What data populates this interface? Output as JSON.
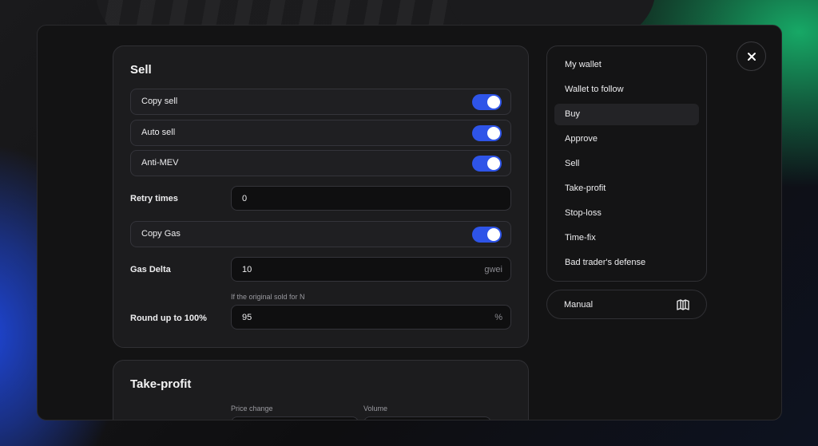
{
  "sell": {
    "title": "Sell",
    "toggles": [
      {
        "label": "Copy sell",
        "on": true
      },
      {
        "label": "Auto sell",
        "on": true
      },
      {
        "label": "Anti-MEV",
        "on": true
      }
    ],
    "retry": {
      "label": "Retry times",
      "value": "0"
    },
    "copy_gas": {
      "label": "Copy Gas",
      "on": true
    },
    "gas_delta": {
      "label": "Gas Delta",
      "value": "10",
      "unit": "gwei"
    },
    "round_up": {
      "hint": "If the original sold for N",
      "label": "Round up to 100%",
      "value": "95",
      "unit": "%"
    }
  },
  "take_profit": {
    "title": "Take-profit",
    "price_change_label": "Price change",
    "volume_label": "Volume"
  },
  "nav": {
    "items": [
      {
        "label": "My wallet"
      },
      {
        "label": "Wallet to follow"
      },
      {
        "label": "Buy",
        "active": true
      },
      {
        "label": "Approve"
      },
      {
        "label": "Sell"
      },
      {
        "label": "Take-profit"
      },
      {
        "label": "Stop-loss"
      },
      {
        "label": "Time-fix"
      },
      {
        "label": "Bad trader's defense"
      }
    ]
  },
  "manual": {
    "label": "Manual",
    "icon": "book-icon"
  },
  "close": {
    "icon": "close-icon"
  },
  "colors": {
    "accent": "#2e54e8",
    "card": "#1c1c1e",
    "modal": "#131314"
  }
}
